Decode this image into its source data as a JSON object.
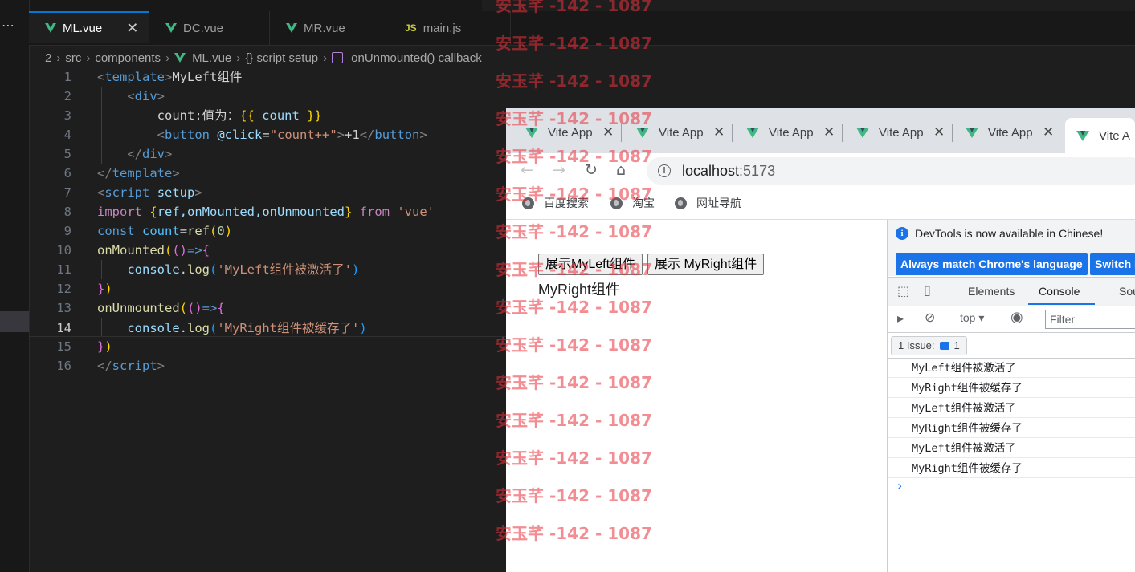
{
  "editor": {
    "tabs": [
      {
        "label": "ML.vue",
        "icon": "vue-icon",
        "active": true
      },
      {
        "label": "DC.vue",
        "icon": "vue-icon"
      },
      {
        "label": "MR.vue",
        "icon": "vue-icon"
      },
      {
        "label": "main.js",
        "icon": "js-icon",
        "icon_text": "JS"
      }
    ],
    "breadcrumb": [
      "2",
      "src",
      "components",
      "ML.vue",
      "{} script setup",
      "onUnmounted() callback"
    ],
    "line_numbers": [
      "1",
      "2",
      "3",
      "4",
      "5",
      "6",
      "7",
      "8",
      "9",
      "10",
      "11",
      "12",
      "13",
      "14",
      "15",
      "16"
    ],
    "current_line": "14",
    "code": {
      "l1_tag": "template",
      "l1_text": "MyLeft组件",
      "l2_tag": "div",
      "l3_text": "count:值为：",
      "l3_expr": "count",
      "l4_tag": "button",
      "l4_attr": "@click",
      "l4_val": "\"count++\"",
      "l4_text": "+1",
      "l5_tag": "div",
      "l6_tag": "template",
      "l7_tag": "script",
      "l7_attr": "setup",
      "l8_kw": "import",
      "l8_names": "ref,onMounted,onUnmounted",
      "l8_from": "from",
      "l8_mod": "'vue'",
      "l9_kw": "const",
      "l9_var": "count",
      "l9_fn": "ref",
      "l9_num": "0",
      "l10_fn": "onMounted",
      "l11_obj": "console",
      "l11_fn": "log",
      "l11_str": "'MyLeft组件被激活了'",
      "l13_fn": "onUnmounted",
      "l14_obj": "console",
      "l14_fn": "log",
      "l14_str": "'MyRight组件被缓存了'",
      "l16_tag": "script"
    }
  },
  "browser": {
    "tabs": [
      "Vite App",
      "Vite App",
      "Vite App",
      "Vite App",
      "Vite App",
      "Vite A"
    ],
    "url_host": "localhost",
    "url_port": ":5173",
    "bookmarks": [
      "百度搜索",
      "淘宝",
      "网址导航"
    ],
    "page": {
      "buttons": [
        "展示MyLeft组件",
        "展示 MyRight组件"
      ],
      "content": "MyRight组件"
    }
  },
  "devtools": {
    "notice": "DevTools is now available in Chinese!",
    "btn_match": "Always match Chrome's language",
    "btn_switch": "Switch DevTools to Chinese",
    "tabs": [
      "Elements",
      "Console",
      "Sources"
    ],
    "active_tab": "Console",
    "context": "top",
    "filter_placeholder": "Filter",
    "issues_label": "1 Issue:",
    "issues_count": "1",
    "logs": [
      "MyLeft组件被激活了",
      "MyRight组件被缓存了",
      "MyLeft组件被激活了",
      "MyRight组件被缓存了",
      "MyLeft组件被激活了",
      "MyRight组件被缓存了"
    ],
    "prompt": "›"
  },
  "watermark": "安玉芊 -142 - 1087",
  "colors": {
    "vue_green": "#41b883",
    "vscode_bg": "#1e1e1e",
    "chrome_blue": "#1a73e8",
    "watermark_red": "#e8323c"
  }
}
